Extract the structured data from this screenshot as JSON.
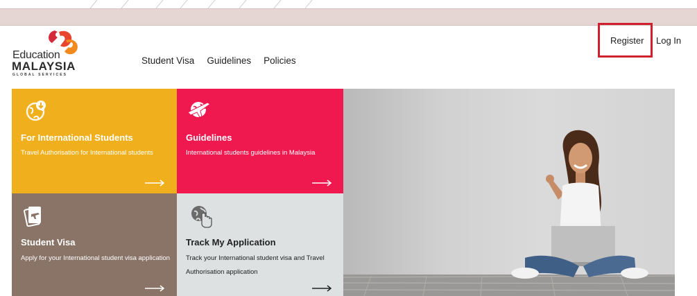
{
  "logo": {
    "line1": "Education",
    "line2": "MALAYSIA",
    "line3": "GLOBAL SERVICES"
  },
  "nav": {
    "items": [
      "Student Visa",
      "Guidelines",
      "Policies"
    ]
  },
  "auth": {
    "register_label": "Register",
    "login_label": "Log In"
  },
  "tiles": [
    {
      "title": "For International Students",
      "description": "Travel Authorisation for International students",
      "icon": "globe-download-icon",
      "color": "#f0b01e"
    },
    {
      "title": "Guidelines",
      "description": "International students guidelines in Malaysia",
      "icon": "globe-plane-icon",
      "color": "#ef1950"
    },
    {
      "title": "Student Visa",
      "description": "Apply for your International student visa application",
      "icon": "passport-icon",
      "color": "#8a7468"
    },
    {
      "title": "Track My Application",
      "description": "Track your International student visa and Travel Authorisation application",
      "icon": "globe-pointer-icon",
      "color": "#dde1e1"
    }
  ],
  "colors": {
    "brand_orange": "#f0b01e",
    "brand_pink": "#ef1950",
    "highlight_red": "#d0202e"
  }
}
